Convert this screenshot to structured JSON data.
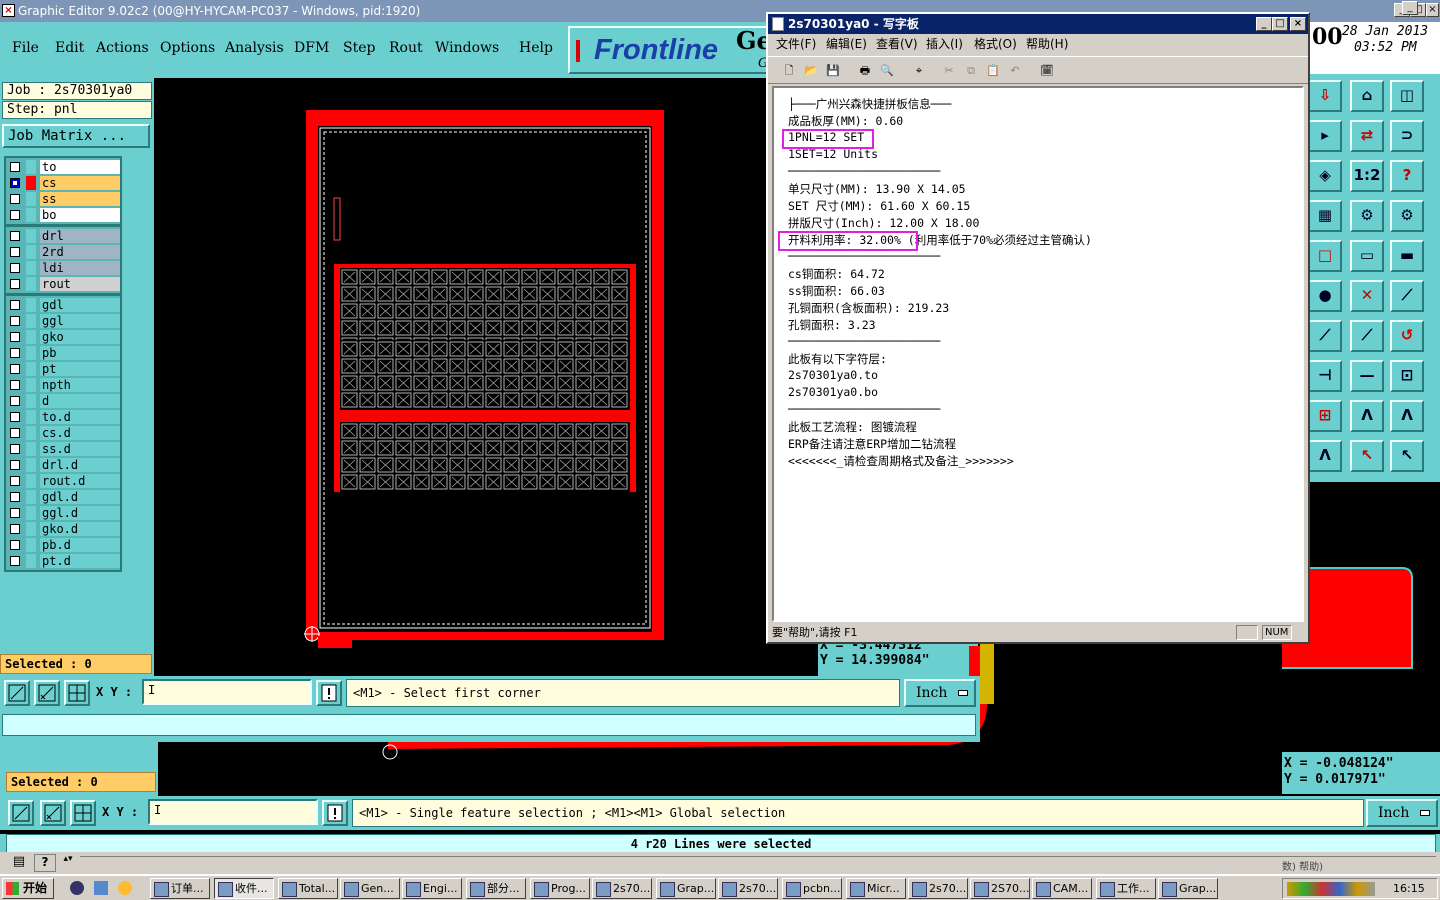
{
  "ge": {
    "title": "Graphic Editor 9.02c2 (00@HY-HYCAM-PC037 - Windows, pid:1920)",
    "menu": [
      "File",
      "Edit",
      "Actions",
      "Options",
      "Analysis",
      "DFM",
      "Step",
      "Rout",
      "Windows",
      "Help"
    ],
    "brand": "Frontline",
    "brand_tail": "Ge",
    "brand_tail2": "G",
    "job_label": "Job : 2s70301ya0",
    "step_label": "Step: pnl",
    "job_matrix": "Job Matrix ...",
    "selected_1": "Selected : 0",
    "selected_2": "Selected : 0",
    "xy_label": "X Y :",
    "cursor_1": "I",
    "cursor_2": "I",
    "msg_1": "<M1> - Select first corner",
    "msg_2": "<M1> - Single feature selection ; <M1><M1> Global selection",
    "unit_1": "Inch",
    "unit_2": "Inch",
    "coord_1_x": "X = -3.447312\"",
    "coord_1_y": "Y = 14.399084\"",
    "coord_2_x": "X = -0.048124\"",
    "coord_2_y": "Y = 0.017971\"",
    "status": "4 r20 Lines were selected",
    "clock_prefix": "00",
    "clock_date": "28 Jan 2013",
    "clock_time": "03:52 PM",
    "hidden_menu_fragment": "数) 帮助)"
  },
  "layers": {
    "board": [
      {
        "name": "to",
        "color": "#ffffff",
        "checked": false
      },
      {
        "name": "cs",
        "color": "#ffcc66",
        "checked": true
      },
      {
        "name": "ss",
        "color": "#ffcc66",
        "checked": false
      },
      {
        "name": "bo",
        "color": "#ffffff",
        "checked": false
      }
    ],
    "drill": [
      {
        "name": "drl",
        "color": "#9fb4c4",
        "checked": false
      },
      {
        "name": "2rd",
        "color": "#9fb4c4",
        "checked": false
      },
      {
        "name": "ldi",
        "color": "#9fb4c4",
        "checked": false
      },
      {
        "name": "rout",
        "color": "#d0d0d0",
        "checked": false
      }
    ],
    "misc": [
      {
        "name": "gdl",
        "color": "#6ccfcf",
        "checked": false
      },
      {
        "name": "ggl",
        "color": "#6ccfcf",
        "checked": false
      },
      {
        "name": "gko",
        "color": "#6ccfcf",
        "checked": false
      },
      {
        "name": "pb",
        "color": "#6ccfcf",
        "checked": false
      },
      {
        "name": "pt",
        "color": "#6ccfcf",
        "checked": false
      },
      {
        "name": "npth",
        "color": "#6ccfcf",
        "checked": false
      },
      {
        "name": "d",
        "color": "#6ccfcf",
        "checked": false
      },
      {
        "name": "to.d",
        "color": "#6ccfcf",
        "checked": false
      },
      {
        "name": "cs.d",
        "color": "#6ccfcf",
        "checked": false
      },
      {
        "name": "ss.d",
        "color": "#6ccfcf",
        "checked": false
      },
      {
        "name": "drl.d",
        "color": "#6ccfcf",
        "checked": false
      },
      {
        "name": "rout.d",
        "color": "#6ccfcf",
        "checked": false
      },
      {
        "name": "gdl.d",
        "color": "#6ccfcf",
        "checked": false
      },
      {
        "name": "ggl.d",
        "color": "#6ccfcf",
        "checked": false
      },
      {
        "name": "gko.d",
        "color": "#6ccfcf",
        "checked": false
      },
      {
        "name": "pb.d",
        "color": "#6ccfcf",
        "checked": false
      },
      {
        "name": "pt.d",
        "color": "#6ccfcf",
        "checked": false
      }
    ]
  },
  "notepad": {
    "title": "2s70301ya0 - 写字板",
    "menu": [
      "文件(F)",
      "编辑(E)",
      "查看(V)",
      "插入(I)",
      "格式(O)",
      "帮助(H)"
    ],
    "lines": [
      "├───广州兴森快捷拼板信息───",
      "成品板厚(MM): 0.60",
      "1PNL=12 SET",
      "1SET=12 Units",
      "──────────────────────",
      "单只尺寸(MM): 13.90 X 14.05",
      "SET 尺寸(MM): 61.60 X 60.15",
      "拼版尺寸(Inch): 12.00 X 18.00",
      "开料利用率: 32.00% (利用率低于70%必须经过主管确认)",
      "──────────────────────",
      "cs铜面积: 64.72",
      "ss铜面积: 66.03",
      "孔铜面积(含板面积): 219.23",
      "孔铜面积: 3.23",
      "──────────────────────",
      "此板有以下字符层:",
      "2s70301ya0.to",
      "2s70301ya0.bo",
      "──────────────────────",
      "此板工艺流程: 图镀流程",
      "ERP备注请注意ERP增加二钻流程",
      "<<<<<<<_请检查周期格式及备注_>>>>>>>"
    ],
    "status": "要\"帮助\",请按 F1",
    "num": "NUM"
  },
  "taskbar": {
    "start": "开始",
    "tasks": [
      "订单...",
      "收件...",
      "Total...",
      "Gen...",
      "Engi...",
      "部分...",
      "Prog...",
      "2s70...",
      "Grap...",
      "2s70...",
      "pcbn...",
      "Micr...",
      "2s70...",
      "2S70...",
      "CAM...",
      "工作...",
      "Grap..."
    ],
    "active_index": 1,
    "time": "16:15"
  },
  "colors": {
    "teal": "#6ccfcf",
    "board_red": "#ff0000",
    "highlight": "#e020e0",
    "title_blue": "#0a246a"
  }
}
